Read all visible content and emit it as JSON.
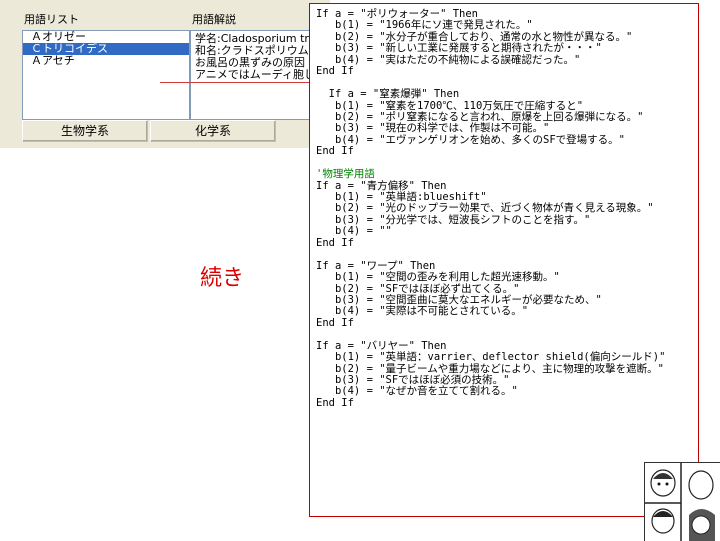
{
  "term_list": {
    "label": "用語リスト",
    "items": [
      {
        "label": "Ａオリゼー",
        "selected": false
      },
      {
        "label": "Ｃトリコイデス",
        "selected": true
      },
      {
        "label": "Ａアセチ",
        "selected": false
      }
    ]
  },
  "term_detail": {
    "label": "用語解説",
    "lines": [
      "学名:Cladosporium tri",
      "和名:クラドスポリウム",
      "お風呂の黒ずみの原因",
      "アニメではムーディ胞し"
    ]
  },
  "tabs": [
    {
      "label": "生物学系"
    },
    {
      "label": "化学系"
    }
  ],
  "continued_label": "続き",
  "code_lines": [
    {
      "text": "If a = \"ポリウォーター\" Then",
      "kind": "code"
    },
    {
      "text": "   b(1) = \"1966年にソ連で発見された。\"",
      "kind": "code"
    },
    {
      "text": "   b(2) = \"水分子が重合しており、通常の水と物性が異なる。\"",
      "kind": "code"
    },
    {
      "text": "   b(3) = \"新しい工業に発展すると期待されたが・・・\"",
      "kind": "code"
    },
    {
      "text": "   b(4) = \"実はただの不純物による誤確認だった。\"",
      "kind": "code"
    },
    {
      "text": "End If",
      "kind": "code"
    },
    {
      "text": "",
      "kind": "code"
    },
    {
      "text": "  If a = \"窒素爆弾\" Then",
      "kind": "code"
    },
    {
      "text": "   b(1) = \"窒素を1700℃、110万気圧で圧縮すると\"",
      "kind": "code"
    },
    {
      "text": "   b(2) = \"ポリ窒素になると言われ、原爆を上回る爆弾になる。\"",
      "kind": "code"
    },
    {
      "text": "   b(3) = \"現在の科学では、作製は不可能。\"",
      "kind": "code"
    },
    {
      "text": "   b(4) = \"エヴァンゲリオンを始め、多くのSFで登場する。\"",
      "kind": "code"
    },
    {
      "text": "End If",
      "kind": "code"
    },
    {
      "text": "",
      "kind": "code"
    },
    {
      "text": "'物理学用語",
      "kind": "comment"
    },
    {
      "text": "If a = \"青方偏移\" Then",
      "kind": "code"
    },
    {
      "text": "   b(1) = \"英単語:blueshift\"",
      "kind": "code"
    },
    {
      "text": "   b(2) = \"光のドップラー効果で、近づく物体が青く見える現象。\"",
      "kind": "code"
    },
    {
      "text": "   b(3) = \"分光学では、短波長シフトのことを指す。\"",
      "kind": "code"
    },
    {
      "text": "   b(4) = \"\"",
      "kind": "code"
    },
    {
      "text": "End If",
      "kind": "code"
    },
    {
      "text": "",
      "kind": "code"
    },
    {
      "text": "If a = \"ワープ\" Then",
      "kind": "code"
    },
    {
      "text": "   b(1) = \"空間の歪みを利用した超光速移動。\"",
      "kind": "code"
    },
    {
      "text": "   b(2) = \"SFではほぼ必ず出てくる。\"",
      "kind": "code"
    },
    {
      "text": "   b(3) = \"空間歪曲に莫大なエネルギーが必要なため、\"",
      "kind": "code"
    },
    {
      "text": "   b(4) = \"実際は不可能とされている。\"",
      "kind": "code"
    },
    {
      "text": "End If",
      "kind": "code"
    },
    {
      "text": "",
      "kind": "code"
    },
    {
      "text": "If a = \"バリヤー\" Then",
      "kind": "code"
    },
    {
      "text": "   b(1) = \"英単語：varrier、deflector shield(偏向シールド)\"",
      "kind": "code"
    },
    {
      "text": "   b(2) = \"量子ビームや重力場などにより、主に物理的攻撃を遮断。\"",
      "kind": "code"
    },
    {
      "text": "   b(3) = \"SFではほぼ必須の技術。\"",
      "kind": "code"
    },
    {
      "text": "   b(4) = \"なぜか音を立てて割れる。\"",
      "kind": "code"
    },
    {
      "text": "End If",
      "kind": "code"
    }
  ],
  "colors": {
    "accent_red": "#d80000",
    "selection_blue": "#316ac5",
    "comment_green": "#008000"
  },
  "icons": [
    "manga-thumbnail"
  ]
}
